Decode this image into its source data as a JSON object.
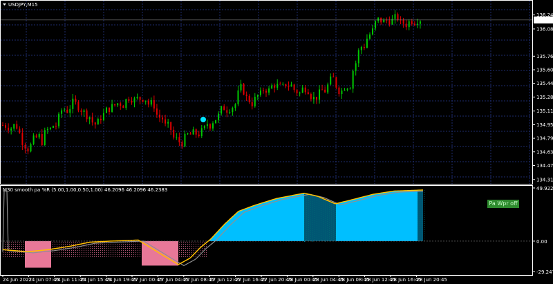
{
  "symbol": "USDJPY,M15",
  "indicator_label": "M30 smooth pa %R (5.00,1.00,0.50,1.00) 46.2096 46.2096 46.2383",
  "indicator_button": "Pa Wpr off",
  "current_price": "136.186",
  "colors": {
    "background": "#000000",
    "grid": "#1e2c6e",
    "bull": "#00c800",
    "bear": "#e00000",
    "area_up": "#00bfff",
    "area_down": "#e87898",
    "line_main": "#ffc000",
    "line_signal": "#909090",
    "marker": "#00e5ff",
    "badge": "#2e8b2e"
  },
  "price_axis": [
    "136.245",
    "136.080",
    "135.760",
    "135.600",
    "135.440",
    "135.280",
    "135.115",
    "134.955",
    "134.795",
    "134.635",
    "134.475",
    "134.310"
  ],
  "indicator_axis": [
    "49.9225",
    "0.00",
    "-29.2477"
  ],
  "time_axis": [
    "24 Jun 2022",
    "24 Jun 07:45",
    "24 Jun 11:45",
    "24 Jun 15:45",
    "24 Jun 19:45",
    "27 Jun 00:45",
    "27 Jun 04:45",
    "27 Jun 08:45",
    "27 Jun 12:45",
    "27 Jun 16:45",
    "27 Jun 20:45",
    "28 Jun 00:45",
    "28 Jun 04:45",
    "28 Jun 08:45",
    "28 Jun 12:45",
    "28 Jun 16:45",
    "28 Jun 20:45"
  ],
  "chart_data": {
    "type": "candlestick",
    "price_path": [
      [
        134.85,
        135.05
      ],
      [
        134.8,
        135.1
      ],
      [
        134.6,
        135.0
      ],
      [
        134.55,
        134.9
      ],
      [
        134.6,
        134.95
      ],
      [
        134.7,
        135.05
      ],
      [
        134.75,
        135.2
      ],
      [
        135.0,
        135.3
      ],
      [
        135.1,
        135.35
      ],
      [
        135.05,
        135.25
      ],
      [
        134.95,
        135.2
      ],
      [
        134.8,
        135.1
      ],
      [
        134.95,
        135.25
      ],
      [
        135.05,
        135.3
      ],
      [
        135.1,
        135.35
      ],
      [
        135.2,
        135.4
      ],
      [
        135.15,
        135.35
      ],
      [
        135.2,
        135.35
      ],
      [
        135.05,
        135.3
      ],
      [
        134.9,
        135.15
      ],
      [
        134.7,
        135.0
      ],
      [
        134.55,
        134.9
      ],
      [
        134.65,
        134.95
      ],
      [
        134.7,
        134.95
      ],
      [
        134.75,
        135.0
      ],
      [
        134.85,
        135.15
      ],
      [
        134.95,
        135.2
      ],
      [
        135.05,
        135.25
      ],
      [
        135.1,
        135.35
      ],
      [
        135.2,
        135.5
      ],
      [
        135.1,
        135.35
      ],
      [
        135.2,
        135.4
      ],
      [
        135.3,
        135.45
      ],
      [
        135.35,
        135.5
      ],
      [
        135.3,
        135.45
      ],
      [
        135.35,
        135.5
      ],
      [
        135.25,
        135.4
      ],
      [
        135.3,
        135.5
      ],
      [
        135.2,
        135.35
      ],
      [
        135.25,
        135.45
      ],
      [
        135.3,
        135.6
      ],
      [
        135.25,
        135.5
      ],
      [
        135.35,
        135.6
      ],
      [
        135.6,
        135.9
      ],
      [
        135.8,
        136.0
      ],
      [
        135.9,
        136.2
      ],
      [
        136.05,
        136.3
      ],
      [
        136.1,
        136.25
      ],
      [
        136.1,
        136.3
      ],
      [
        136.05,
        136.2
      ],
      [
        136.1,
        136.3
      ],
      [
        136.15,
        136.3
      ]
    ],
    "indicator_zero": 0.0,
    "indicator_max": 49.9225,
    "indicator_min": -29.2477
  }
}
